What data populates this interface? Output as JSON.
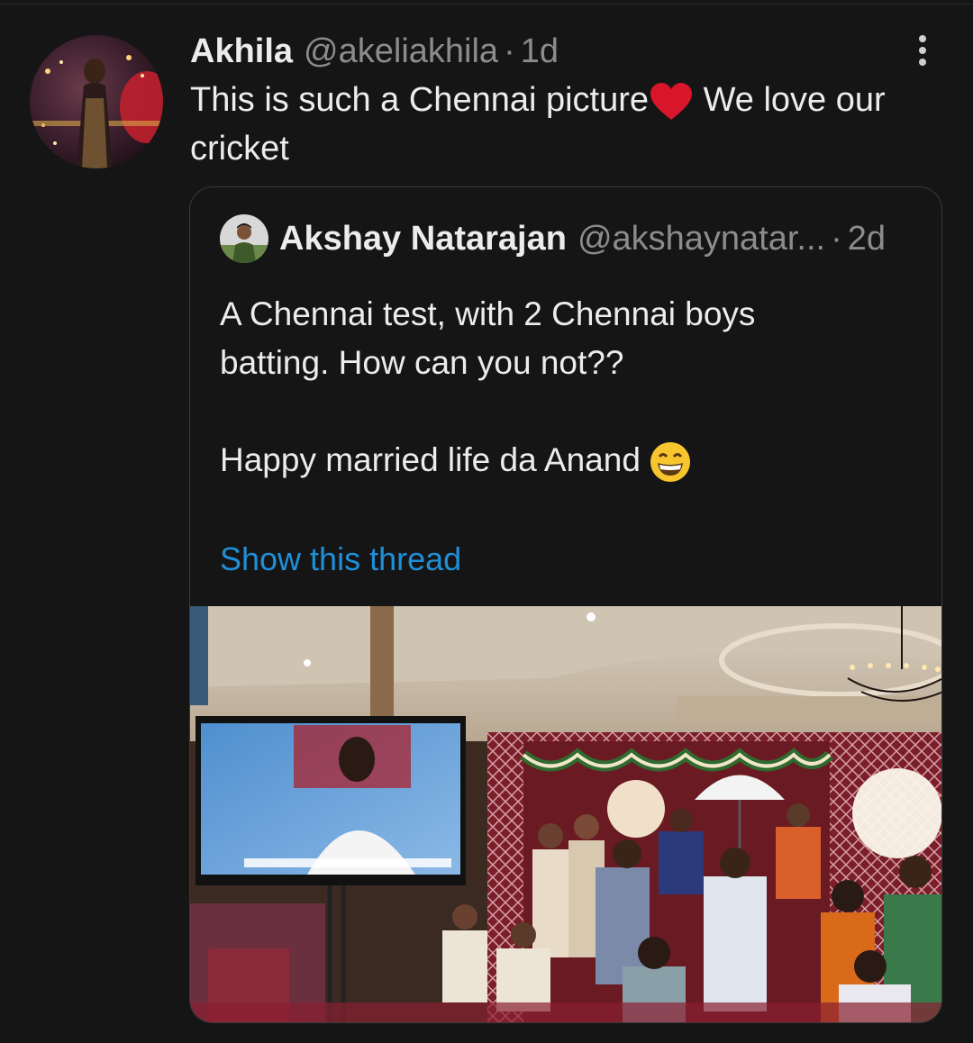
{
  "tweet": {
    "author_name": "Akhila",
    "author_handle": "@akeliakhila",
    "separator": "·",
    "timestamp": "1d",
    "text_line1_a": "This is such a Chennai picture",
    "text_line1_b": " We love our",
    "text_line2": "cricket",
    "emoji": "heart-icon"
  },
  "quoted_tweet": {
    "author_name": "Akshay Natarajan",
    "author_handle": "@akshaynatar...",
    "separator": "·",
    "timestamp": "2d",
    "text_line1": "A Chennai test, with 2 Chennai boys",
    "text_line2": "batting. How can you not??",
    "text_line3": "Happy married life da Anand",
    "ellipsis": "...",
    "show_thread_label": "Show this thread",
    "emoji": "grinning-face-icon"
  },
  "colors": {
    "background": "#151515",
    "text": "#ececec",
    "muted": "#8c8c8c",
    "link": "#1f8fd8",
    "border": "#3a3a3a"
  }
}
